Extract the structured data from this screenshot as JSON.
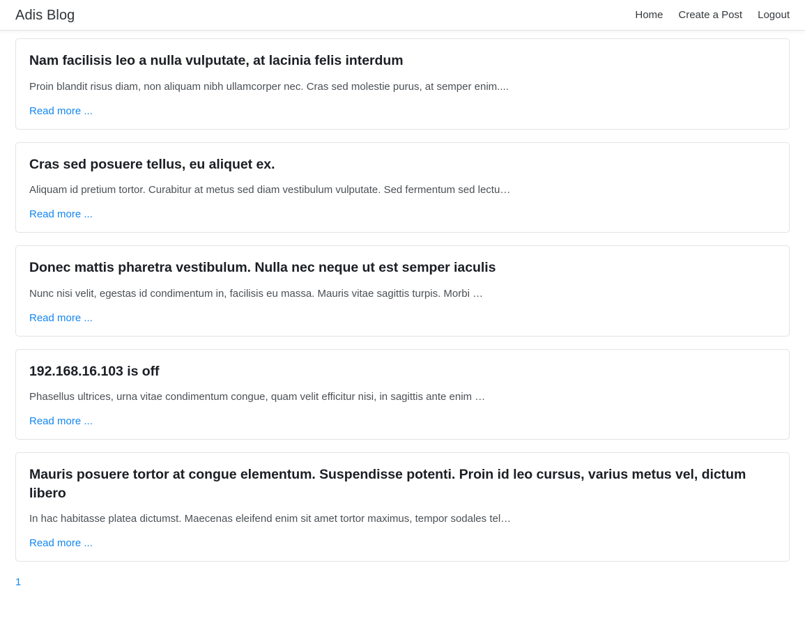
{
  "navbar": {
    "brand": "Adis Blog",
    "links": [
      {
        "label": "Home"
      },
      {
        "label": "Create a Post"
      },
      {
        "label": "Logout"
      }
    ]
  },
  "posts": [
    {
      "title": "Nam facilisis leo a nulla vulputate, at lacinia felis interdum",
      "excerpt": "Proin blandit risus diam, non aliquam nibh ullamcorper nec. Cras sed molestie purus, at semper enim....",
      "read_more": "Read more ..."
    },
    {
      "title": "Cras sed posuere tellus, eu aliquet ex.",
      "excerpt": "Aliquam id pretium tortor. Curabitur at metus sed diam vestibulum vulputate. Sed fermentum sed lectu…",
      "read_more": "Read more ..."
    },
    {
      "title": "Donec mattis pharetra vestibulum. Nulla nec neque ut est semper iaculis",
      "excerpt": "Nunc nisi velit, egestas id condimentum in, facilisis eu massa. Mauris vitae sagittis turpis. Morbi …",
      "read_more": "Read more ..."
    },
    {
      "title": "192.168.16.103 is off",
      "excerpt": "Phasellus ultrices, urna vitae condimentum congue, quam velit efficitur nisi, in sagittis ante enim …",
      "read_more": "Read more ..."
    },
    {
      "title": "Mauris posuere tortor at congue elementum. Suspendisse potenti. Proin id leo cursus, varius metus vel, dictum libero",
      "excerpt": "In hac habitasse platea dictumst. Maecenas eleifend enim sit amet tortor maximus, tempor sodales tel…",
      "read_more": "Read more ..."
    }
  ],
  "pagination": {
    "pages": [
      {
        "label": "1"
      }
    ]
  },
  "colors": {
    "link": "#1386f0",
    "title": "#1b1f24",
    "body_text": "#4b5055",
    "card_border": "#e3e3e6",
    "navbar_border": "#e9e9ec"
  }
}
